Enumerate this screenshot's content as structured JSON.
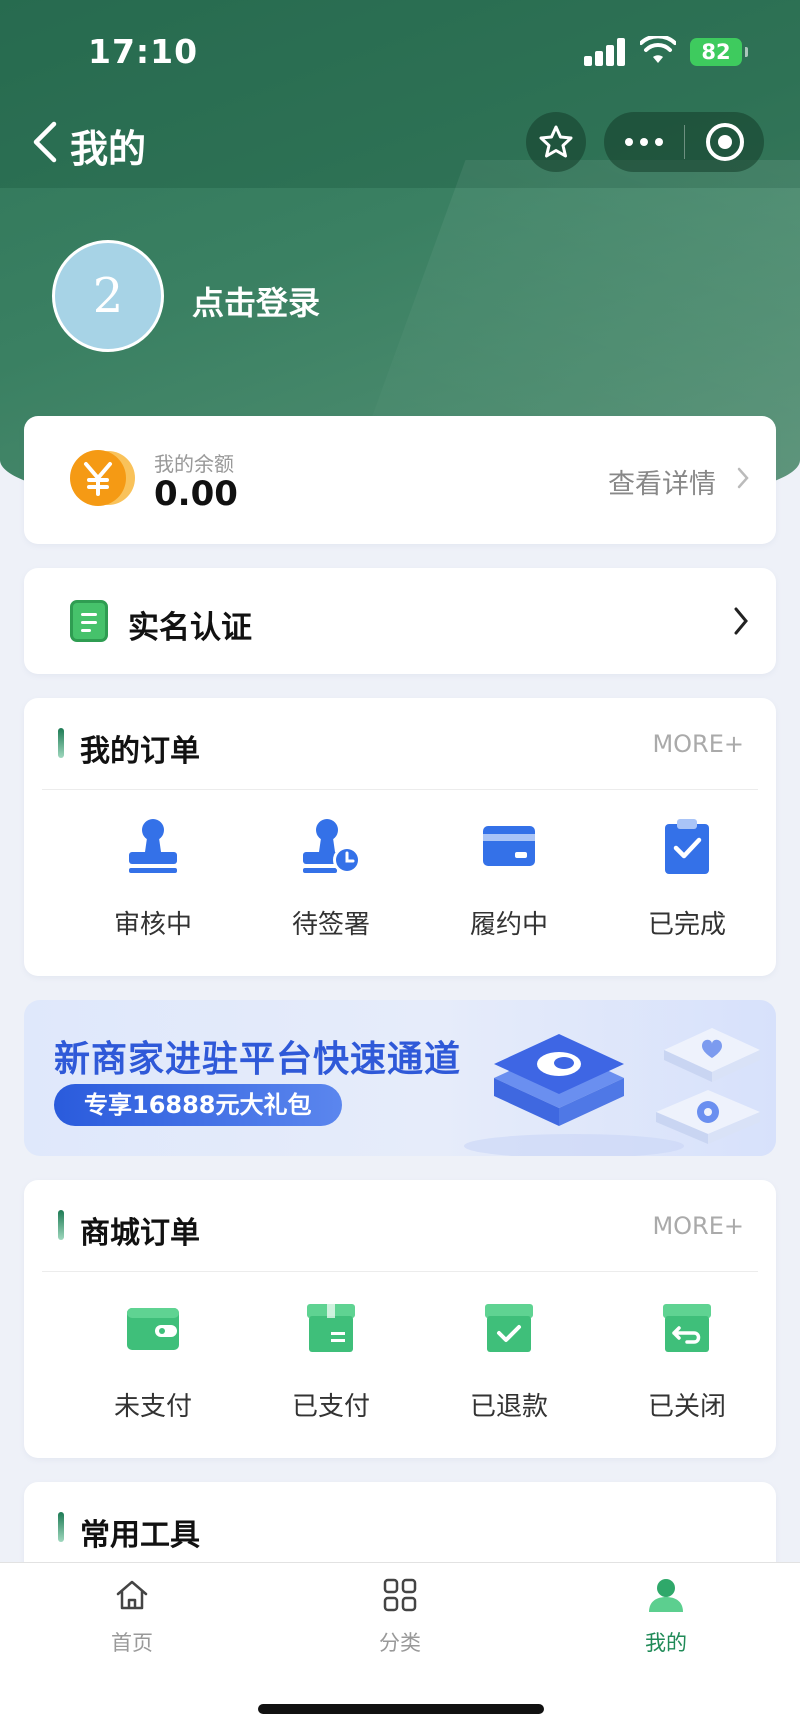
{
  "status_bar": {
    "time": "17:10",
    "battery": "82"
  },
  "nav": {
    "title": "我的",
    "back_icon": "chevron-left-icon",
    "star_icon": "star-icon",
    "more_icon": "more-dots-icon",
    "close_icon": "target-icon"
  },
  "profile": {
    "avatar_text": "2",
    "login_label": "点击登录"
  },
  "balance": {
    "label": "我的余额",
    "value": "0.00",
    "detail_label": "查看详情",
    "icon": "yuan-coin-icon"
  },
  "verify": {
    "title": "实名认证",
    "icon": "document-icon"
  },
  "orders": {
    "title": "我的订单",
    "more": "MORE+",
    "items": [
      {
        "label": "审核中",
        "icon": "stamp-icon"
      },
      {
        "label": "待签署",
        "icon": "stamp-clock-icon"
      },
      {
        "label": "履约中",
        "icon": "card-icon"
      },
      {
        "label": "已完成",
        "icon": "clipboard-check-icon"
      }
    ]
  },
  "banner": {
    "title": "新商家进驻平台快速通道",
    "pill": "专享16888元大礼包"
  },
  "shop_orders": {
    "title": "商城订单",
    "more": "MORE+",
    "items": [
      {
        "label": "未支付",
        "icon": "wallet-icon"
      },
      {
        "label": "已支付",
        "icon": "box-icon"
      },
      {
        "label": "已退款",
        "icon": "box-check-icon"
      },
      {
        "label": "已关闭",
        "icon": "box-return-icon"
      }
    ]
  },
  "tools": {
    "title": "常用工具"
  },
  "tabbar": {
    "items": [
      {
        "label": "首页",
        "icon": "home-icon"
      },
      {
        "label": "分类",
        "icon": "grid-icon"
      },
      {
        "label": "我的",
        "icon": "user-icon"
      }
    ],
    "active": "我的"
  },
  "colors": {
    "header": "#3a8062",
    "accent_blue": "#2f59d8",
    "accent_green": "#1f8a57",
    "coin_orange": "#f6a21d"
  }
}
